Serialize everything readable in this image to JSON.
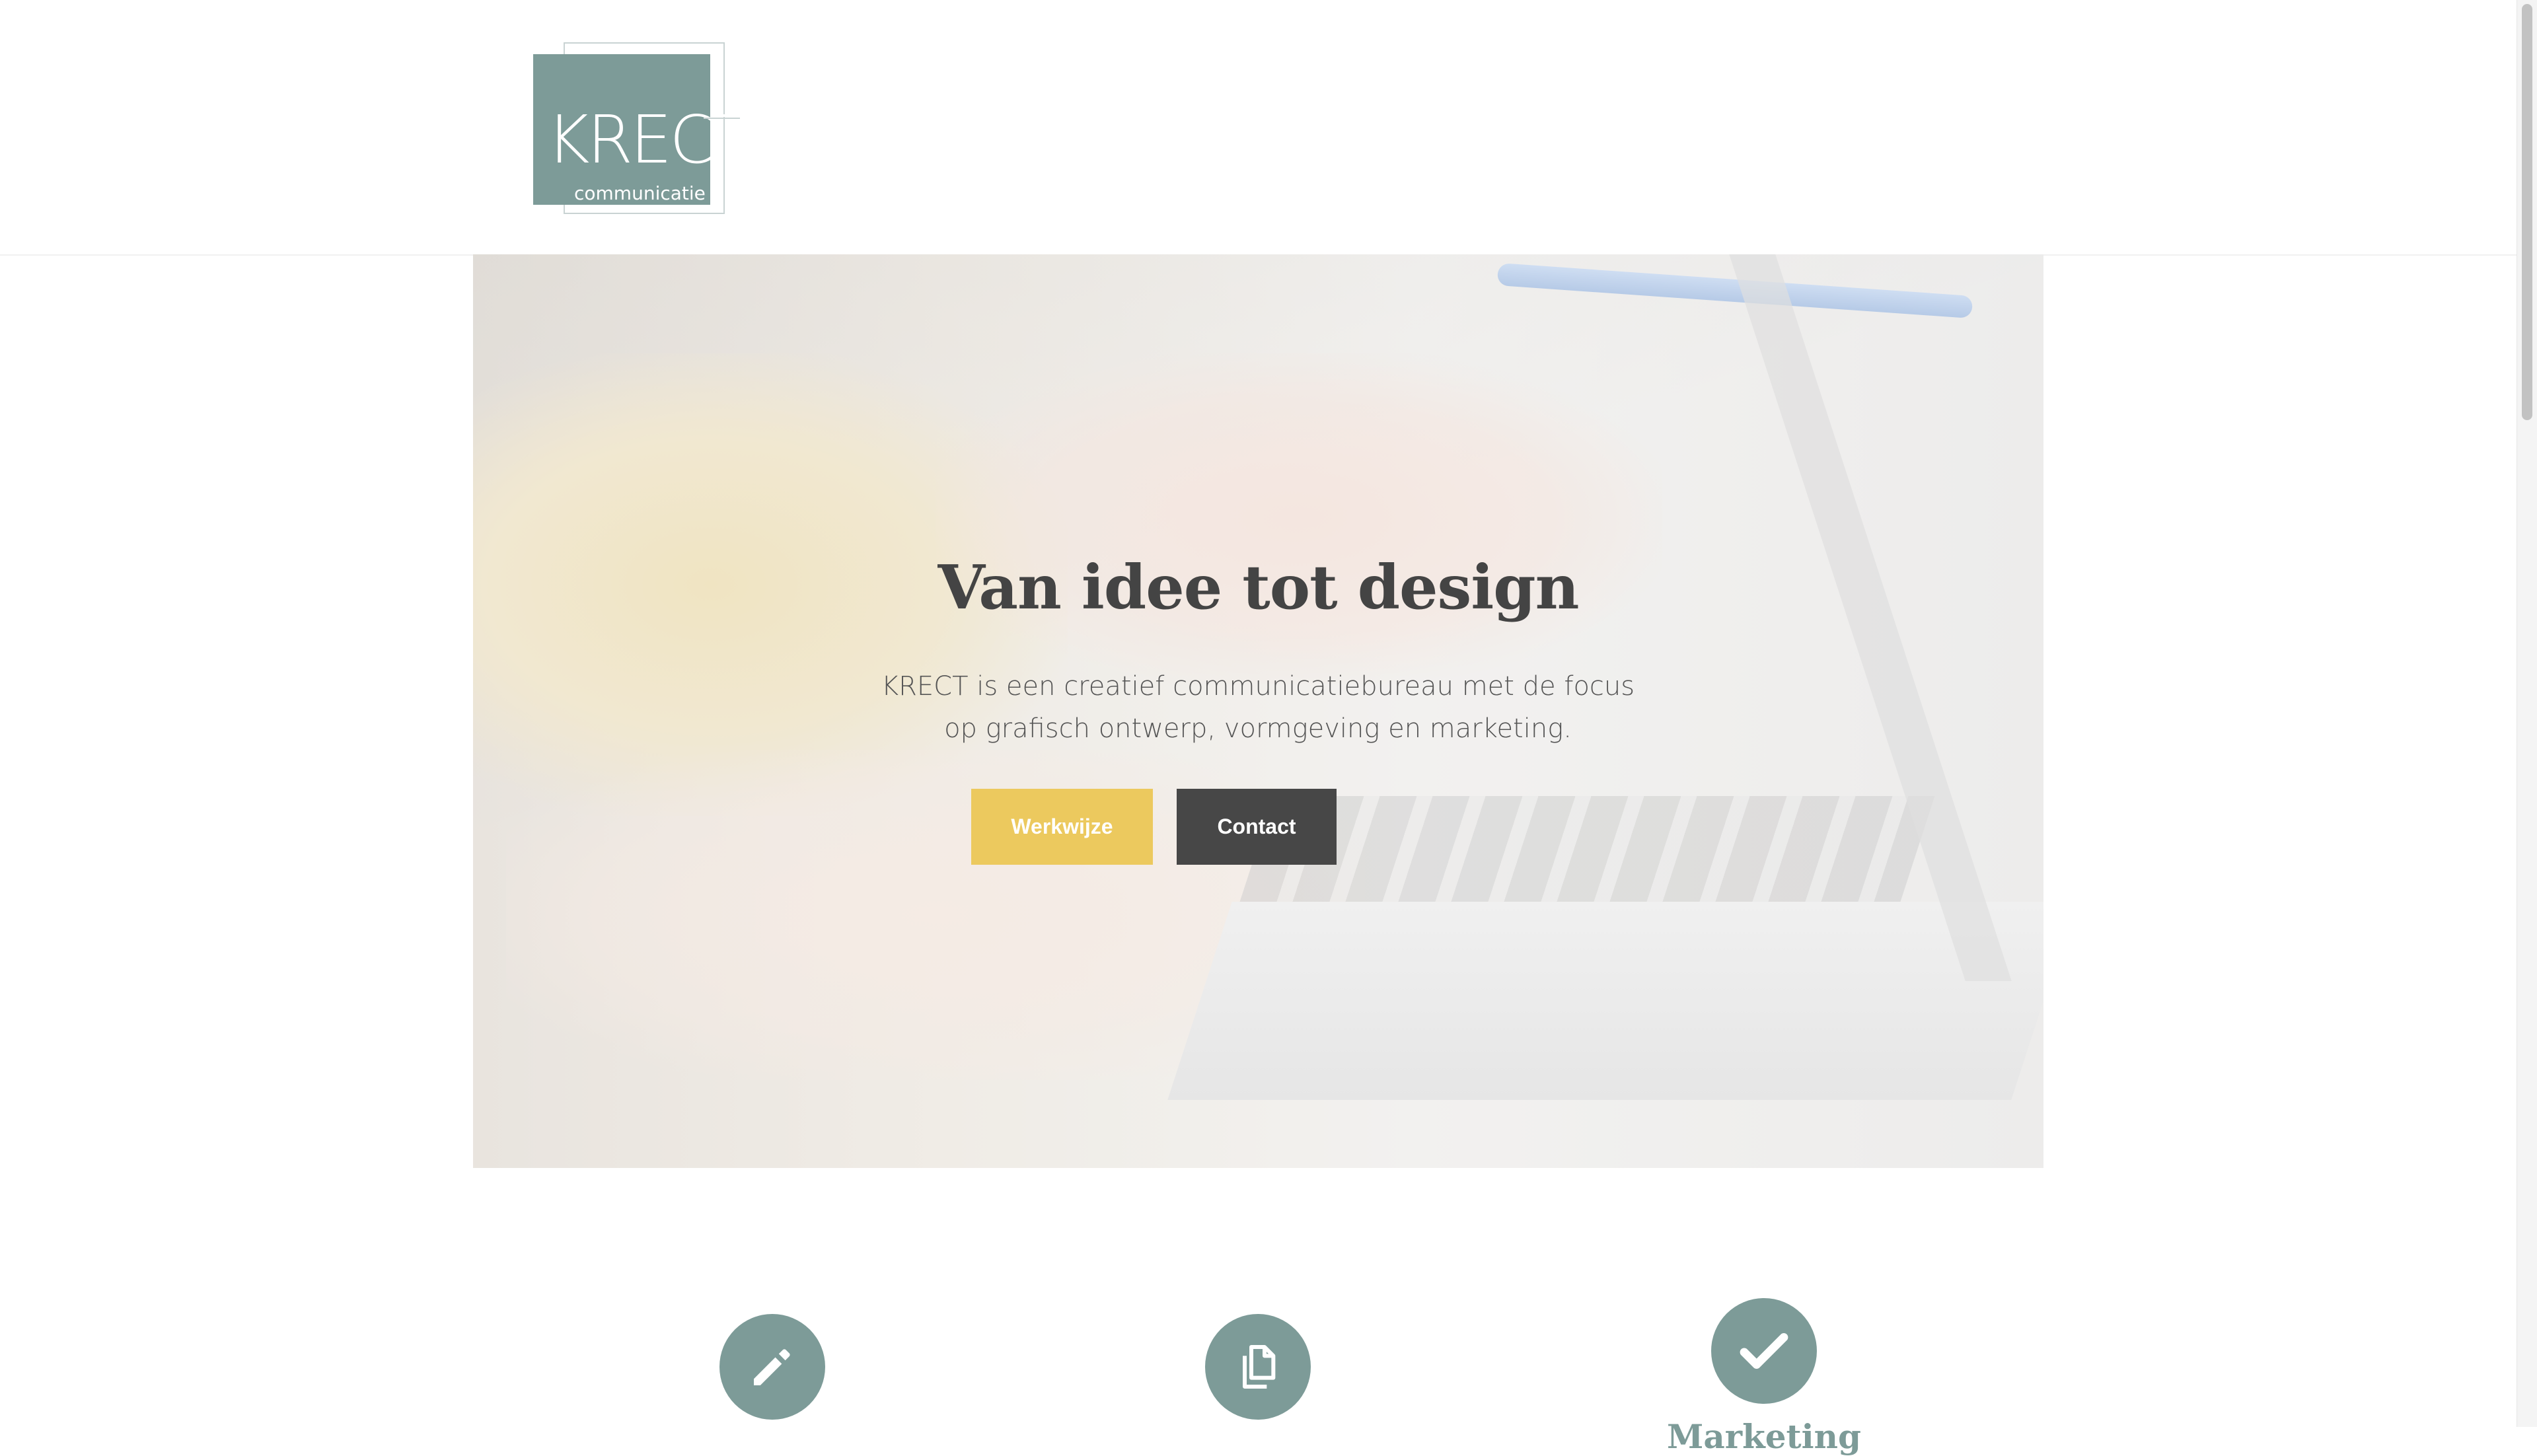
{
  "logo": {
    "word": "KRECT",
    "sub": "communicatie"
  },
  "hero": {
    "title": "Van idee tot design",
    "text_line1": "KRECT is een creatief communicatiebureau met de focus",
    "text_line2": "op grafisch ontwerp, vormgeving en marketing.",
    "button_primary": "Werkwijze",
    "button_secondary": "Contact"
  },
  "features": [
    {
      "icon": "pencil-icon",
      "title": ""
    },
    {
      "icon": "copy-icon",
      "title": ""
    },
    {
      "icon": "check-icon",
      "title": "Marketing"
    }
  ],
  "colors": {
    "accent": "#7d9b98",
    "button_yellow": "#ecc95e",
    "button_dark": "#474747",
    "heading": "#444444"
  }
}
